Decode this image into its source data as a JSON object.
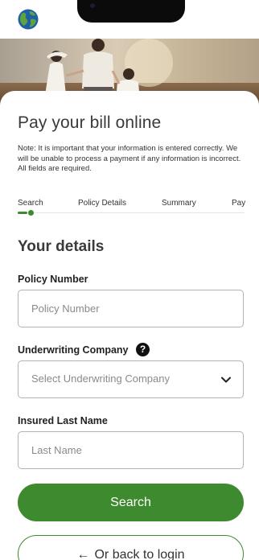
{
  "header": {
    "logo_icon": "globe-logo-icon"
  },
  "form": {
    "title": "Pay your bill online",
    "note": "Note: It is important that your information is entered correctly. We will be unable to process a payment if any information is incorrect. All fields are required.",
    "steps": [
      "Search",
      "Policy Details",
      "Summary",
      "Pay"
    ],
    "active_step": "Search",
    "section_title": "Your details",
    "policy_number": {
      "label": "Policy Number",
      "placeholder": "Policy Number"
    },
    "underwriting_company": {
      "label": "Underwriting Company",
      "placeholder": "Select Underwriting Company",
      "help_icon": "question-circle-icon"
    },
    "last_name": {
      "label": "Insured Last Name",
      "placeholder": "Last Name"
    },
    "search_label": "Search",
    "back_label": "Or back to login"
  },
  "colors": {
    "accent": "#3e8a2e",
    "logo_blue": "#1f5fa8",
    "logo_green": "#5ea33c"
  }
}
